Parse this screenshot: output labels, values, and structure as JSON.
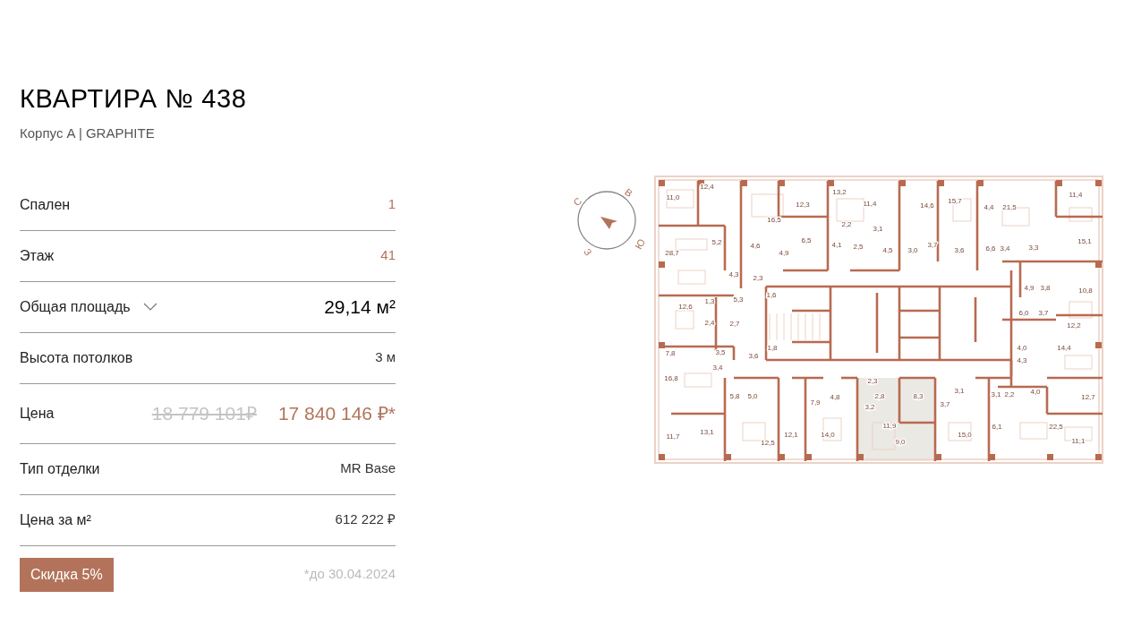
{
  "title": "КВАРТИРА № 438",
  "subtitle": "Корпус A | GRAPHITE",
  "rows": [
    {
      "kind": "plain",
      "label": "Спален",
      "value": "1",
      "accent": true
    },
    {
      "kind": "plain",
      "label": "Этаж",
      "value": "41",
      "accent": true
    },
    {
      "kind": "area",
      "label": "Общая площадь",
      "value": "29,14 м²",
      "expanded": false
    },
    {
      "kind": "plain",
      "label": "Высота потолков",
      "value": "3 м",
      "accent": false
    },
    {
      "kind": "price",
      "label": "Цена",
      "old_value": "18 779 101₽",
      "value": "17 840 146 ₽*"
    },
    {
      "kind": "plain",
      "label": "Тип отделки",
      "value": "MR Base",
      "accent": false
    },
    {
      "kind": "plain",
      "label": "Цена за м²",
      "value": "612 222 ₽",
      "accent": false
    }
  ],
  "discount": {
    "label": "Скидка 5%",
    "note": "*до 30.04.2024"
  },
  "compass": [
    "С",
    "В",
    "Ю",
    "З"
  ],
  "plan_labels": [
    "12,4",
    "11,0",
    "16,5",
    "12,3",
    "5,2",
    "4,6",
    "6,5",
    "28,7",
    "4,9",
    "4,3",
    "2,3",
    "12,6",
    "1,3",
    "5,3",
    "1,6",
    "13,2",
    "11,4",
    "14,6",
    "15,7",
    "4,4",
    "21,5",
    "11,4",
    "2,2",
    "3,1",
    "4,1",
    "2,5",
    "4,5",
    "3,0",
    "3,7",
    "3,6",
    "6,6",
    "3,4",
    "3,3",
    "15,1",
    "4,9",
    "3,8",
    "10,8",
    "6,0",
    "3,7",
    "2,4",
    "2,7",
    "7,8",
    "3,5",
    "3,6",
    "1,8",
    "3,4",
    "16,8",
    "5,8",
    "5,0",
    "2,3",
    "7,9",
    "4,8",
    "3,2",
    "11,7",
    "13,1",
    "12,5",
    "12,1",
    "14,0",
    "12,2",
    "4,0",
    "14,4",
    "4,3",
    "2,8",
    "8,3",
    "3,7",
    "3,1",
    "3,1",
    "2,2",
    "4,0",
    "12,7",
    "11,9",
    "9,0",
    "15,0",
    "6,1",
    "22,5",
    "11,1"
  ]
}
